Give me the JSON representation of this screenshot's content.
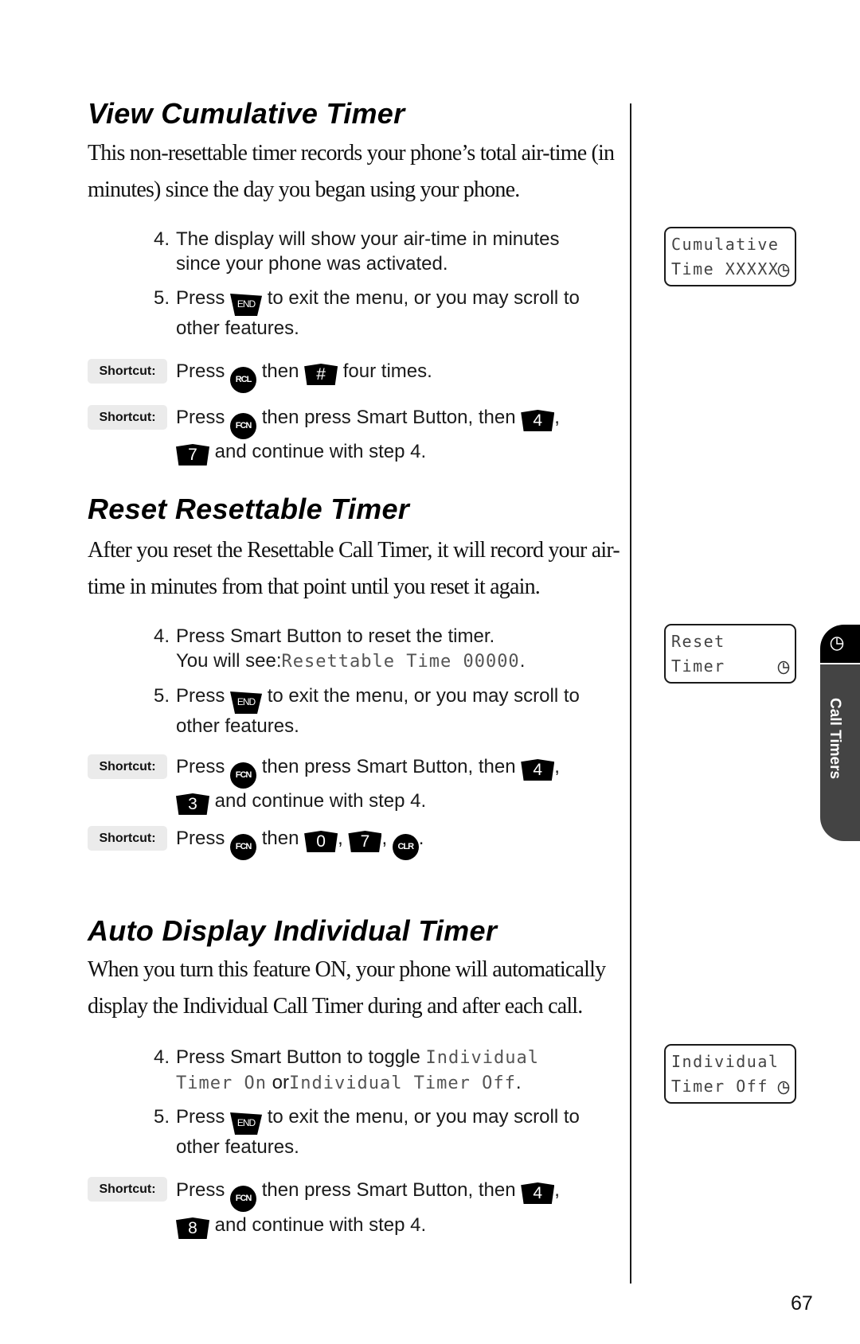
{
  "page_number": "67",
  "side_tab": {
    "label": "Call Timers",
    "icon": "clock-icon"
  },
  "sections": [
    {
      "title": "View Cumulative Timer",
      "intro_lines": [
        "This non-resettable timer records your phone’s total air-time (in",
        "minutes) since the day you began using your phone."
      ],
      "steps": [
        {
          "num": "4.",
          "text": "The display will show your air-time in minutes since your phone was activated."
        },
        {
          "num": "5.",
          "pre": "Press",
          "key": "END",
          "post": "to exit the menu, or you may scroll to other features."
        }
      ],
      "shortcuts": [
        {
          "label": "Shortcut:",
          "pre": "Press",
          "key1": "RCL",
          "mid": "then",
          "key2": "#",
          "post": "four times."
        },
        {
          "label": "Shortcut:",
          "pre": "Press",
          "key1": "FCN",
          "mid": "then press Smart Button, then",
          "key2": "4",
          "sep": ",",
          "key3": "7",
          "post": "and continue with step 4."
        }
      ],
      "display": {
        "line1": "Cumulative",
        "line2": "Time XXXXX",
        "icon": "clock-icon"
      }
    },
    {
      "title": "Reset Resettable Timer",
      "intro_lines": [
        "After you reset the Resettable Call Timer, it will record your air-",
        "time in minutes from that point until you reset it again."
      ],
      "steps": [
        {
          "num": "4.",
          "text": "Press Smart Button to reset the timer.",
          "text2": "You will see:",
          "lcd": "Resettable Time 00000",
          "end": "."
        },
        {
          "num": "5.",
          "pre": "Press",
          "key": "END",
          "post": "to exit the menu, or you may scroll to other features."
        }
      ],
      "shortcuts": [
        {
          "label": "Shortcut:",
          "pre": "Press",
          "key1": "FCN",
          "mid": "then press Smart Button, then",
          "key2": "4",
          "sep": ",",
          "key3": "3",
          "post": "and continue with step 4."
        },
        {
          "label": "Shortcut:",
          "pre": "Press",
          "key1": "FCN",
          "mid": "then",
          "key2": "0",
          "key3": "7",
          "key4": "CLR",
          "sep": ",",
          "end": "."
        }
      ],
      "display": {
        "line1": "Reset",
        "line2": "Timer",
        "icon": "clock-icon"
      }
    },
    {
      "title": "Auto Display Individual Timer",
      "intro_lines": [
        "When you turn this feature ON, your phone will automatically",
        "display the Individual Call Timer during and after each call."
      ],
      "steps": [
        {
          "num": "4.",
          "text": "Press Smart Button to toggle",
          "lcd1": "Individual",
          "lcd2": "Timer On",
          "or": "or",
          "lcd3": "Individual Timer Off",
          "end": "."
        },
        {
          "num": "5.",
          "pre": "Press",
          "key": "END",
          "post": "to exit the menu, or you may scroll to other features."
        }
      ],
      "shortcuts": [
        {
          "label": "Shortcut:",
          "pre": "Press",
          "key1": "FCN",
          "mid": "then press Smart Button, then",
          "key2": "4",
          "sep": ",",
          "key3": "8",
          "post": "and continue with step 4."
        }
      ],
      "display": {
        "line1": "Individual",
        "line2": "Timer Off",
        "icon": "clock-icon"
      }
    }
  ]
}
